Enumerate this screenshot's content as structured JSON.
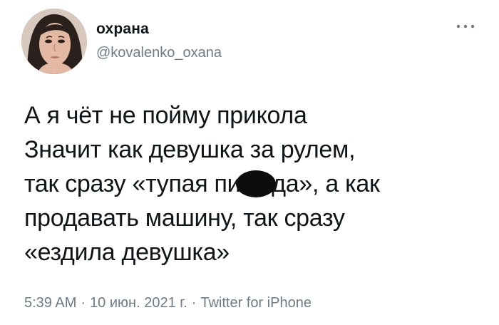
{
  "author": {
    "display_name": "охрана",
    "handle": "@kovalenko_oxana"
  },
  "tweet": {
    "lines": [
      "А я чёт не пойму прикола",
      "Значит как девушка за рулем,",
      [
        "так сразу «тупая пи",
        "да», а как"
      ],
      "продавать машину, так сразу",
      "«ездила девушка»"
    ]
  },
  "meta": {
    "time": "5:39 AM",
    "separator": "·",
    "date": "10 июн. 2021 г.",
    "source": "Twitter for iPhone"
  },
  "colors": {
    "text": "#0f1419",
    "secondary": "#6e7b87",
    "censor": "#0d0d0d"
  },
  "icons": {
    "more": "more-dots-icon",
    "censor": "censor-blot"
  }
}
